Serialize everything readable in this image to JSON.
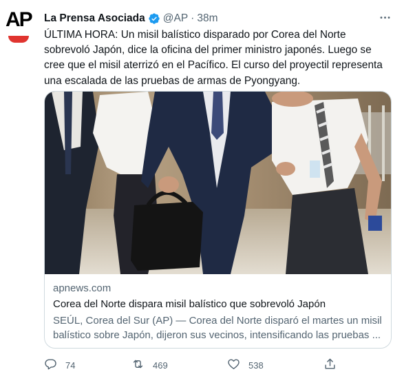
{
  "account": {
    "name": "La Prensa Asociada",
    "handle": "@AP",
    "separator": "·",
    "time": "38m",
    "avatar_logo": "AP",
    "verified_color": "#1d9bf0"
  },
  "tweet": {
    "text": "ÚLTIMA HORA: Un misil balístico disparado por Corea del Norte sobrevoló Japón, dice la oficina del primer ministro japonés. Luego se cree que el misil aterrizó en el Pacífico. El curso del proyectil representa una escalada de las pruebas de armas de Pyongyang."
  },
  "card": {
    "domain": "apnews.com",
    "title": "Corea del Norte dispara misil balístico que sobrevoló Japón",
    "description": "SEÚL, Corea del Sur (AP) — Corea del Norte disparó el martes un misil balístico sobre Japón, dijeron sus vecinos, intensificando las pruebas ..."
  },
  "actions": {
    "replies": "74",
    "retweets": "469",
    "likes": "538"
  },
  "icons": {
    "more": "more-horizontal-icon",
    "reply": "reply-icon",
    "retweet": "retweet-icon",
    "like": "heart-icon",
    "share": "share-icon",
    "verified": "verified-badge-icon"
  },
  "colors": {
    "text_primary": "#0f1419",
    "text_secondary": "#536471",
    "ap_red": "#e0342f",
    "border": "#cfd9de"
  }
}
